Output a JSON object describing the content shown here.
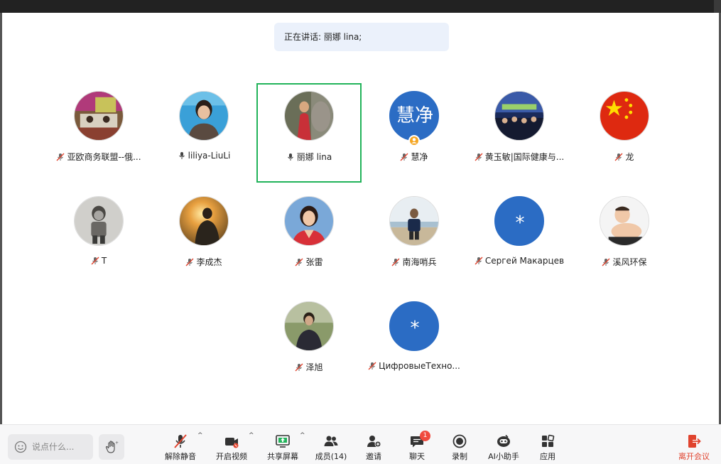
{
  "speaking_banner": "正在讲话: 丽娜 lina;",
  "participants": [
    {
      "name": "亚欧商务联盟--俄...",
      "mic": "muted"
    },
    {
      "name": "liliya-LiuLi",
      "mic": "on"
    },
    {
      "name": "丽娜 lina",
      "mic": "on",
      "active": true
    },
    {
      "name": "慧净",
      "mic": "muted",
      "avatar_text": "慧净",
      "host": true
    },
    {
      "name": "黄玉敏|国际健康与...",
      "mic": "muted"
    },
    {
      "name": "龙",
      "mic": "muted"
    },
    {
      "name": "T",
      "mic": "muted"
    },
    {
      "name": "李成杰",
      "mic": "muted"
    },
    {
      "name": "张雷",
      "mic": "muted"
    },
    {
      "name": "南海哨兵",
      "mic": "muted"
    },
    {
      "name": "Сергей Макарцев",
      "mic": "muted",
      "avatar_text": "*"
    },
    {
      "name": "溪风环保",
      "mic": "muted"
    },
    {
      "name": "泽旭",
      "mic": "muted"
    },
    {
      "name": "ЦифровыеТехно...",
      "mic": "muted",
      "avatar_text": "*"
    }
  ],
  "toolbar": {
    "chat_placeholder": "说点什么...",
    "unmute": "解除静音",
    "start_video": "开启视频",
    "share_screen": "共享屏幕",
    "members": "成员(14)",
    "invite": "邀请",
    "chat": "聊天",
    "chat_badge": "1",
    "record": "录制",
    "ai_assistant": "AI小助手",
    "apps": "应用",
    "leave": "离开会议"
  },
  "colors": {
    "active_border": "#21b35a",
    "avatar_blue": "#2b6cc4",
    "leave_red": "#e0432e",
    "badge_red": "#f04b3f"
  }
}
